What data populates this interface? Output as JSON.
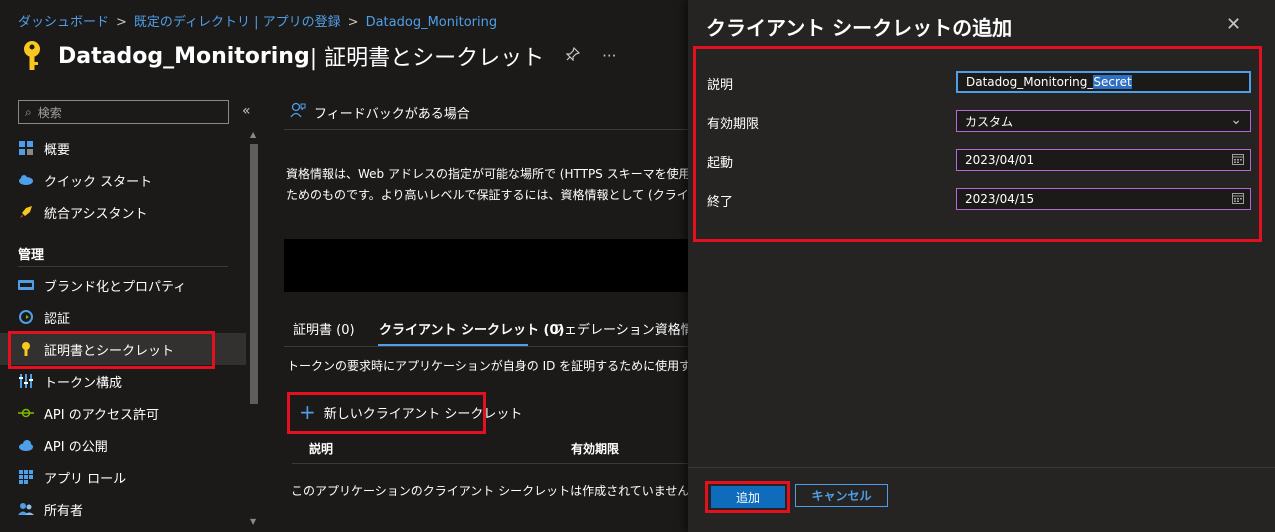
{
  "breadcrumb": {
    "items": [
      "ダッシュボード",
      "既定のディレクトリ | アプリの登録",
      "Datadog_Monitoring"
    ]
  },
  "header": {
    "app_name": "Datadog_Monitoring",
    "section": " | 証明書とシークレット",
    "pin_icon": "pin-icon",
    "more": "···"
  },
  "sidebar": {
    "search_placeholder": "検索",
    "collapse": "«",
    "top_items": [
      {
        "label": "概要",
        "icon": "overview-icon"
      },
      {
        "label": "クイック スタート",
        "icon": "quickstart-icon"
      },
      {
        "label": "統合アシスタント",
        "icon": "rocket-icon"
      }
    ],
    "heading": "管理",
    "manage_items": [
      {
        "label": "ブランド化とプロパティ",
        "icon": "branding-icon"
      },
      {
        "label": "認証",
        "icon": "auth-icon"
      },
      {
        "label": "証明書とシークレット",
        "icon": "key-icon"
      },
      {
        "label": "トークン構成",
        "icon": "token-icon"
      },
      {
        "label": "API のアクセス許可",
        "icon": "api-permission-icon"
      },
      {
        "label": "API の公開",
        "icon": "cloud-icon"
      },
      {
        "label": "アプリ ロール",
        "icon": "app-roles-icon"
      },
      {
        "label": "所有者",
        "icon": "owners-icon"
      }
    ]
  },
  "main": {
    "feedback": "フィードバックがある場合",
    "info_line1": "資格情報は、Web アドレスの指定が可能な場所で (HTTPS スキーマを使用して",
    "info_line2": "ためのものです。より高いレベルで保証するには、資格情報として (クライアント シー",
    "tabs": [
      "証明書 (0)",
      "クライアント シークレット (0)",
      "フェデレーション資格情報"
    ],
    "tab_description": "トークンの要求時にアプリケーションが自身の ID を証明するために使用する秘密",
    "new_secret": "新しいクライアント シークレット",
    "col_description": "説明",
    "col_expires": "有効期限",
    "empty": "このアプリケーションのクライアント シークレットは作成されていません。"
  },
  "panel": {
    "title": "クライアント シークレットの追加",
    "close": "✕",
    "description_label": "説明",
    "description_value_a": "Datadog_Monitoring_",
    "description_value_b": "Secret",
    "expires_label": "有効期限",
    "expires_value": "カスタム",
    "start_label": "起動",
    "start_value": "2023/04/01",
    "end_label": "終了",
    "end_value": "2023/04/15",
    "add_button": "追加",
    "cancel_button": "キャンセル"
  },
  "colors": {
    "highlight_red": "#e3101f",
    "link_blue": "#4f9fe8",
    "key_yellow": "#f8c81e"
  }
}
